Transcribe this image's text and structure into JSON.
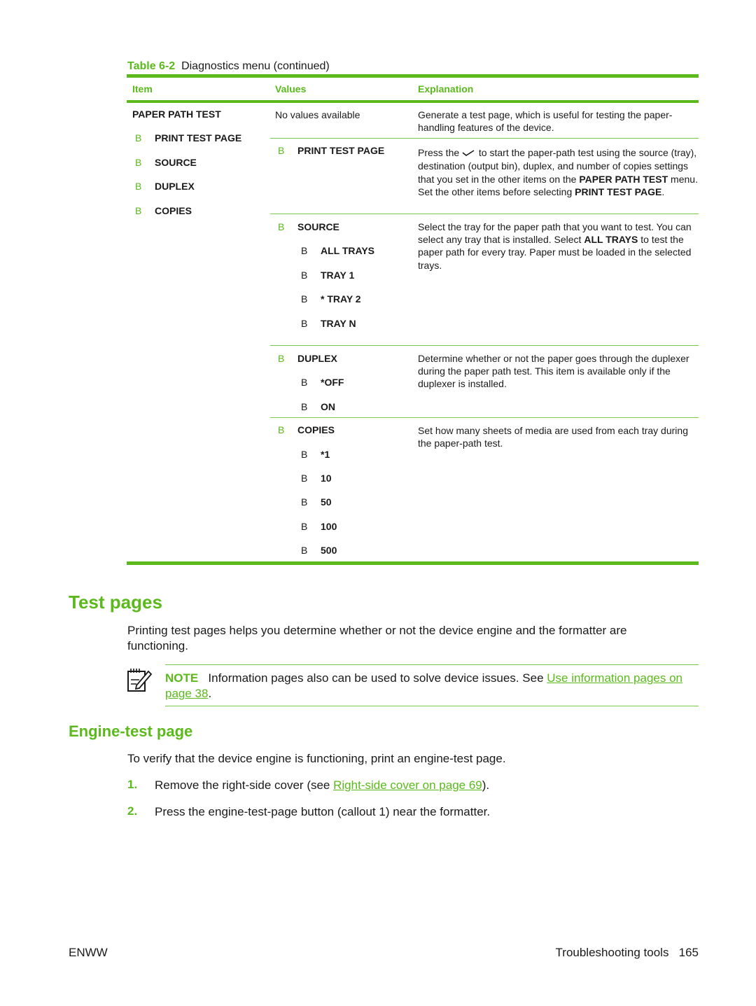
{
  "table": {
    "caption_label": "Table 6-2",
    "caption_text": "Diagnostics menu (continued)",
    "headers": {
      "item": "Item",
      "values": "Values",
      "explanation": "Explanation"
    },
    "item_column": {
      "title": "PAPER PATH TEST",
      "subitems": [
        {
          "bullet": "B",
          "label": "PRINT TEST PAGE"
        },
        {
          "bullet": "B",
          "label": "SOURCE"
        },
        {
          "bullet": "B",
          "label": "DUPLEX"
        },
        {
          "bullet": "B",
          "label": "COPIES"
        }
      ]
    },
    "rows": [
      {
        "values_text": "No values available",
        "explanation": "Generate a test page, which is useful for testing the paper-handling features of the device."
      },
      {
        "value": {
          "bullet": "B",
          "label": "PRINT TEST PAGE"
        },
        "explanation_parts": {
          "p1": "Press the",
          "icon": "checkmark-icon",
          "p2": "to start the paper-path test using the source (tray), destination (output bin), duplex, and number of copies settings that you set in the other items on the",
          "b1": "PAPER PATH TEST",
          "p3": "menu. Set the other items before selecting",
          "b2": "PRINT TEST PAGE",
          "p4": "."
        }
      },
      {
        "value": {
          "bullet": "B",
          "label": "SOURCE"
        },
        "options": [
          {
            "bullet": "B",
            "label": "ALL TRAYS"
          },
          {
            "bullet": "B",
            "label": "TRAY 1"
          },
          {
            "bullet": "B",
            "label": "* TRAY 2"
          },
          {
            "bullet": "B",
            "label": "TRAY N"
          }
        ],
        "explanation_parts": {
          "p1": "Select the tray for the paper path that you want to test. You can select any tray that is installed. Select",
          "b1": "ALL TRAYS",
          "p2": "to test the paper path for every tray. Paper must be loaded in the selected trays."
        }
      },
      {
        "value": {
          "bullet": "B",
          "label": "DUPLEX"
        },
        "options": [
          {
            "bullet": "B",
            "label": "*OFF"
          },
          {
            "bullet": "B",
            "label": "ON"
          }
        ],
        "explanation": "Determine whether or not the paper goes through the duplexer during the paper path test. This item is available only if the duplexer is installed."
      },
      {
        "value": {
          "bullet": "B",
          "label": "COPIES"
        },
        "options": [
          {
            "bullet": "B",
            "label": "*1"
          },
          {
            "bullet": "B",
            "label": "10"
          },
          {
            "bullet": "B",
            "label": "50"
          },
          {
            "bullet": "B",
            "label": "100"
          },
          {
            "bullet": "B",
            "label": "500"
          }
        ],
        "explanation": "Set how many sheets of media are used from each tray during the paper-path test."
      }
    ]
  },
  "test_pages": {
    "heading": "Test pages",
    "intro": "Printing test pages helps you determine whether or not the device engine and the formatter are functioning.",
    "note": {
      "icon": "note-pencil-icon",
      "label": "NOTE",
      "text": "Information pages also can be used to solve device issues. See",
      "link_text": "Use information pages on page 38",
      "after": "."
    }
  },
  "engine_test": {
    "heading": "Engine-test page",
    "intro": "To verify that the device engine is functioning, print an engine-test page.",
    "steps": [
      {
        "num": "1.",
        "text_before": "Remove the right-side cover (see",
        "link_text": "Right-side cover on page 69",
        "text_after": ")."
      },
      {
        "num": "2.",
        "text": "Press the engine-test-page button (callout 1) near the formatter."
      }
    ]
  },
  "footer": {
    "left": "ENWW",
    "section": "Troubleshooting tools",
    "page": "165"
  },
  "colors": {
    "accent": "#5bb91c"
  }
}
